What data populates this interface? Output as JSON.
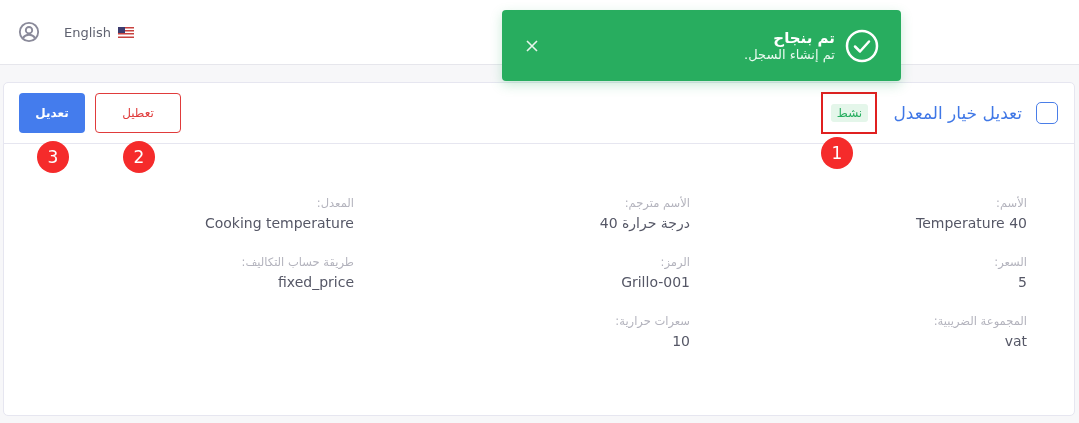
{
  "topbar": {
    "language": "English"
  },
  "toast": {
    "title": "تم بنجاح",
    "message": "تم إنشاء السجل."
  },
  "card": {
    "title": "تعديل خيار المعدل",
    "checkbox": {
      "checked": false
    },
    "status_badge": "نشط",
    "buttons": [
      {
        "label": "تعطيل",
        "kind": "outline"
      },
      {
        "label": "تعديل",
        "kind": "primary"
      }
    ],
    "fields": [
      {
        "label": "الأسم:",
        "value": "Temperature 40"
      },
      {
        "label": "الأسم مترجم:",
        "value": "درجة حرارة 40"
      },
      {
        "label": "المعدل:",
        "value": "Cooking temperature"
      },
      {
        "label": "السعر:",
        "value": "5"
      },
      {
        "label": "الرمز:",
        "value": "Grillo-001"
      },
      {
        "label": "طريقة حساب التكاليف:",
        "value": "fixed_price"
      },
      {
        "label": "المجموعة الضريبية:",
        "value": "vat"
      },
      {
        "label": "سعرات حرارية:",
        "value": "10"
      }
    ]
  },
  "annotations": [
    "1",
    "2",
    "3"
  ]
}
